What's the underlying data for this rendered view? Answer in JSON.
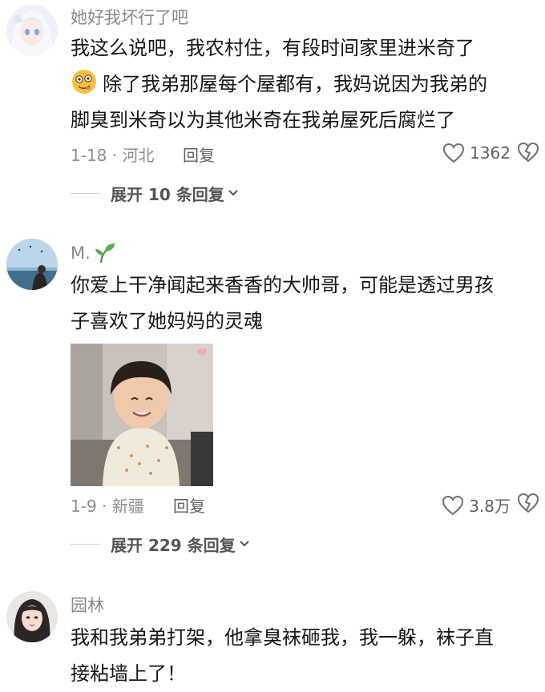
{
  "comments": [
    {
      "username": "她好我坏行了吧",
      "text_line1": "我这么说吧，我农村住，有段时间家里进米奇了",
      "text_line2": "除了我弟那屋每个屋都有，我妈说因为我弟的",
      "text_line3": "脚臭到米奇以为其他米奇在我弟屋死后腐烂了",
      "date_location": "1-18 · 河北",
      "reply_label": "回复",
      "likes": "1362",
      "expand_label": "展开 10 条回复"
    },
    {
      "username": "M.",
      "text_line1": "你爱上干净闻起来香香的大帅哥，可能是透过男孩",
      "text_line2": "子喜欢了她妈妈的灵魂",
      "date_location": "1-9 · 新疆",
      "reply_label": "回复",
      "likes": "3.8万",
      "expand_label": "展开 229 条回复"
    },
    {
      "username": "园林",
      "text_line1": "我和我弟弟打架，他拿臭袜砸我，我一躲，袜子直",
      "text_line2": "接粘墙上了！"
    }
  ],
  "icons": {
    "like": "heart-outline-icon",
    "dislike": "broken-heart-icon",
    "expand": "chevron-down-icon",
    "emoji": "drooling-face-emoji",
    "username_badge": "sprout-icon"
  },
  "colors": {
    "text": "#161616",
    "meta": "#8e8e8e",
    "username": "#8a8a8a"
  }
}
